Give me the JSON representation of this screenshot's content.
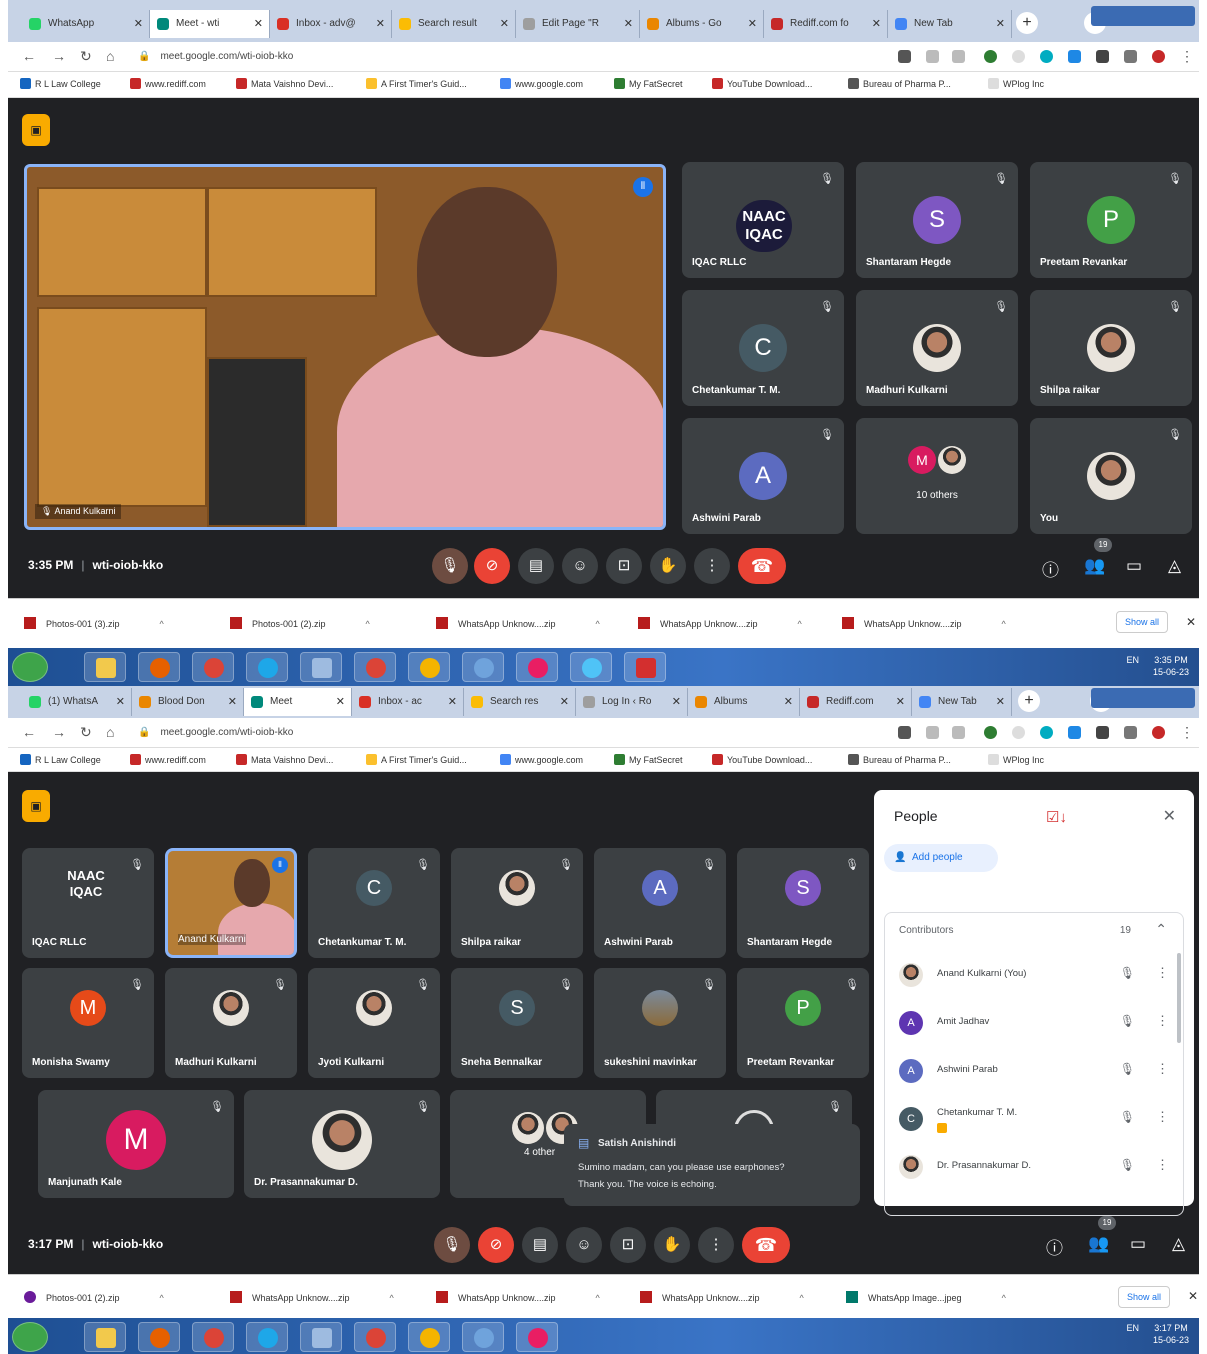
{
  "shot1": {
    "tabs": [
      "WhatsApp",
      "Meet - wti",
      "Inbox - adv@",
      "Search result",
      "Edit Page \"R",
      "Albums - Go",
      "Rediff.com fo",
      "New Tab"
    ],
    "url": "meet.google.com/wti-oiob-kko",
    "bookmarks": [
      "R L Law College",
      "www.rediff.com",
      "Mata Vaishno Devi...",
      "A First Timer's Guid...",
      "www.google.com",
      "My FatSecret",
      "YouTube Download...",
      "Bureau of Pharma P...",
      "WPlog Inc"
    ],
    "speaker_label": "Anand Kulkarni",
    "tiles": [
      {
        "name": "IQAC RLLC",
        "logo": [
          "NAAC",
          "IQAC"
        ]
      },
      {
        "name": "Shantaram Hegde",
        "initial": "S",
        "color": "#7e57c2"
      },
      {
        "name": "Preetam Revankar",
        "initial": "P",
        "color": "#43a047"
      },
      {
        "name": "Chetankumar T. M.",
        "initial": "C",
        "color": "#455a64"
      },
      {
        "name": "Madhuri Kulkarni"
      },
      {
        "name": "Shilpa raikar"
      },
      {
        "name": "Ashwini Parab",
        "initial": "A",
        "color": "#5c6bc0"
      },
      {
        "name": "10 others",
        "initial": "M",
        "color": "#d81b60"
      },
      {
        "name": "You"
      }
    ],
    "time": "3:35 PM",
    "code": "wti-oiob-kko",
    "people_count": "19",
    "downloads": [
      "Photos-001 (3).zip",
      "Photos-001 (2).zip",
      "WhatsApp Unknow....zip",
      "WhatsApp Unknow....zip",
      "WhatsApp Unknow....zip"
    ],
    "show_all": "Show all",
    "tray": {
      "lang": "EN",
      "time": "3:35 PM",
      "date": "15-06-23"
    }
  },
  "shot2": {
    "tabs": [
      "(1) WhatsA",
      "Blood Don",
      "Meet",
      "Inbox - ac",
      "Search res",
      "Log In ‹ Ro",
      "Albums",
      "Rediff.com",
      "New Tab"
    ],
    "url": "meet.google.com/wti-oiob-kko",
    "bookmarks": [
      "R L Law College",
      "www.rediff.com",
      "Mata Vaishno Devi...",
      "A First Timer's Guid...",
      "www.google.com",
      "My FatSecret",
      "YouTube Download...",
      "Bureau of Pharma P...",
      "WPlog Inc"
    ],
    "tiles": [
      {
        "name": "IQAC RLLC",
        "logo": [
          "NAAC",
          "IQAC"
        ]
      },
      {
        "name": "Anand Kulkarni"
      },
      {
        "name": "Chetankumar T. M.",
        "initial": "C",
        "color": "#455a64"
      },
      {
        "name": "Shilpa raikar"
      },
      {
        "name": "Ashwini Parab",
        "initial": "A",
        "color": "#5c6bc0"
      },
      {
        "name": "Shantaram Hegde",
        "initial": "S",
        "color": "#7e57c2"
      },
      {
        "name": "Monisha Swamy",
        "initial": "M",
        "color": "#e64a19"
      },
      {
        "name": "Madhuri Kulkarni"
      },
      {
        "name": "Jyoti Kulkarni"
      },
      {
        "name": "Sneha Bennalkar",
        "initial": "S",
        "color": "#455a64"
      },
      {
        "name": "sukeshini mavinkar"
      },
      {
        "name": "Preetam Revankar",
        "initial": "P",
        "color": "#43a047"
      },
      {
        "name": "Manjunath Kale",
        "initial": "M",
        "color": "#d81b60"
      },
      {
        "name": "Dr. Prasannakumar D."
      },
      {
        "name": "4 other"
      },
      {
        "name": ""
      }
    ],
    "toast": {
      "sender": "Satish Anishindi",
      "msg1": "Sumino madam, can you please use earphones?",
      "msg2": "Thank you. The voice is echoing."
    },
    "panel": {
      "title": "People",
      "add": "Add people",
      "section": "Contributors",
      "section_count": "19",
      "people": [
        {
          "name": "Anand Kulkarni (You)",
          "initial": "",
          "color": "#8d6e63"
        },
        {
          "name": "Amit Jadhav",
          "initial": "A",
          "color": "#5e35b1"
        },
        {
          "name": "Ashwini Parab",
          "initial": "A",
          "color": "#5c6bc0"
        },
        {
          "name": "Chetankumar T. M.",
          "initial": "C",
          "color": "#455a64"
        },
        {
          "name": "Dr. Prasannakumar D.",
          "initial": "",
          "color": "#8d6e63"
        }
      ]
    },
    "time": "3:17 PM",
    "code": "wti-oiob-kko",
    "people_count": "19",
    "downloads": [
      "Photos-001 (2).zip",
      "WhatsApp Unknow....zip",
      "WhatsApp Unknow....zip",
      "WhatsApp Unknow....zip",
      "WhatsApp Image...jpeg"
    ],
    "show_all": "Show all",
    "tray": {
      "lang": "EN",
      "time": "3:17 PM",
      "date": "15-06-23"
    }
  }
}
